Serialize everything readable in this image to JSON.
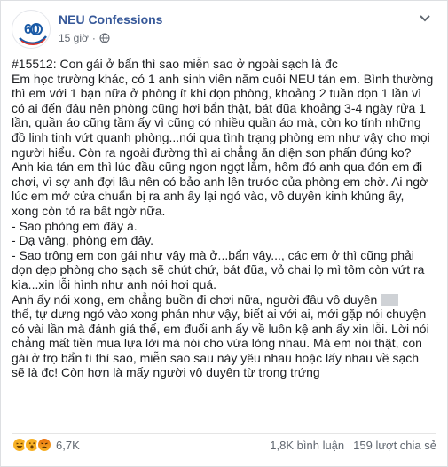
{
  "post": {
    "page_name": "NEU Confessions",
    "time": "15 giờ",
    "avatar_text": "60",
    "lines": [
      "#15512: Con gái ở bẩn thì sao     miễn sao ở ngoài sạch là đc",
      "Em học trường khác, có 1 anh sinh viên năm cuối NEU tán em. Bình thường",
      "thì em với 1 bạn nữa ở phòng ít khi dọn phòng, khoảng 2 tuần dọn 1 lần vì",
      "có ai đến đâu nên phòng cũng hơi bẩn thật, bát đũa khoảng 3-4 ngày rửa 1",
      "lần, quần áo cũng tầm ấy vì cũng có nhiều quần áo mà, còn ko tính những",
      "đồ linh tinh vứt quanh phòng...nói qua tình trạng phòng em như vậy cho mọi",
      "người hiểu. Còn ra ngoài đường thì ai chẳng ăn diện son phấn đúng ko?",
      "Anh kia tán em thì lúc đầu cũng ngon ngọt lắm, hôm đó anh qua đón em đi",
      "chơi, vì sợ anh đợi lâu nên có bảo anh lên trước của phòng em chờ. Ai ngờ",
      "lúc em mở cửa chuẩn bị ra anh ấy lại ngó vào, vô duyên kinh khủng ấy,",
      "xong còn tỏ ra bất ngờ nữa.",
      "- Sao phòng em đây á.",
      "- Dạ vâng, phòng em đây.",
      "- Sao trông em con gái như vậy mà ở...bẩn vậy..., các em ở thì cũng phải",
      "dọn dẹp phòng cho sạch sẽ chút chứ, bát đũa, vỏ chai lọ mì tôm còn vứt ra",
      "kìa...xin lỗi hình như anh nói hơi quá.",
      "Anh ấy nói xong, em chẳng buồn đi chơi nữa, người đâu vô duyên",
      "thế, tự dưng ngó vào xong phán như vậy, biết ai với ai, mới gặp nói chuyện",
      "có vài lần mà đánh giá thế, em đuổi anh ấy về luôn kệ anh ấy xin lỗi. Lời nói",
      "chẳng mất tiền mua lựa lời mà nói cho vừa lòng nhau. Mà em nói thật, con",
      "gái ở trọ bẩn tí thì sao, miễn sao sau này yêu nhau hoặc lấy nhau về sạch",
      "sẽ là đc! Còn hơn là mấy người vô duyên từ trong trứng"
    ]
  },
  "footer": {
    "reaction_count": "6,7K",
    "shares": "1,8K bình luận",
    "comments": "159 lượt chia sẻ"
  },
  "colors": {
    "brand_blue": "#365899",
    "like_blue": "#1877f2",
    "haha_yellow": "#f7b125",
    "angry_orange": "#e9710f"
  },
  "icons": [
    "globe-icon",
    "chevron-down-icon",
    "haha-reaction-icon",
    "wow-reaction-icon",
    "angry-reaction-icon"
  ]
}
